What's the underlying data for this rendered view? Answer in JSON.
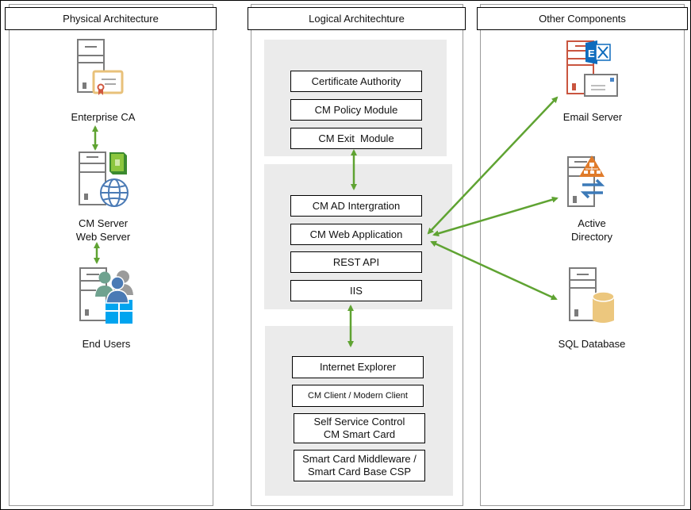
{
  "columns": {
    "physical": {
      "title": "Physical Architecture",
      "nodes": [
        {
          "label": "Enterprise CA",
          "icon": "server-certificate-icon"
        },
        {
          "label_lines": [
            "CM Server",
            "Web Server"
          ],
          "icon": "server-web-globe-icon"
        },
        {
          "label": "End Users",
          "icon": "server-users-windows-icon"
        }
      ]
    },
    "logical": {
      "title": "Logical Architechture",
      "groups": [
        {
          "name": "ca-group",
          "items": [
            "Certificate Authority",
            "CM Policy Module",
            "CM Exit  Module"
          ]
        },
        {
          "name": "server-group",
          "items": [
            "CM AD Intergration",
            "CM Web Application",
            "REST API",
            "IIS"
          ]
        },
        {
          "name": "client-group",
          "items": [
            "Internet Explorer",
            "CM Client / Modern Client",
            "Self Service Control\nCM Smart Card",
            "Smart Card Middleware /\nSmart Card Base CSP"
          ]
        }
      ]
    },
    "other": {
      "title": "Other Components",
      "nodes": [
        {
          "label": "Email Server",
          "icon": "exchange-email-server-icon"
        },
        {
          "label_lines": [
            "Active",
            "Directory"
          ],
          "icon": "active-directory-icon"
        },
        {
          "label": "SQL Database",
          "icon": "sql-database-icon"
        }
      ]
    }
  },
  "connectors": [
    {
      "from": "Enterprise CA",
      "to": "CM Server / Web Server",
      "type": "bidirectional"
    },
    {
      "from": "CM Server / Web Server",
      "to": "End Users",
      "type": "bidirectional"
    },
    {
      "from": "CM Exit  Module",
      "to": "CM AD Intergration",
      "type": "bidirectional"
    },
    {
      "from": "IIS",
      "to": "Internet Explorer",
      "type": "bidirectional"
    },
    {
      "from": "CM Web Application",
      "to": "Email Server",
      "type": "bidirectional"
    },
    {
      "from": "CM Web Application",
      "to": "Active Directory",
      "type": "bidirectional"
    },
    {
      "from": "CM Web Application",
      "to": "SQL Database",
      "type": "bidirectional"
    }
  ],
  "colors": {
    "arrow": "#5fa332",
    "panel": "#ebebeb",
    "certificate": "#e8c17a",
    "ribbon": "#d0573f",
    "globe": "#4a7ab5",
    "exchange": "#0f6cbd",
    "email_server": "#c9553f",
    "ad_triangle": "#e07b2a",
    "ad_arrows": "#3c7ab8",
    "database": "#ecc77e",
    "windows": "#00a4ef"
  }
}
